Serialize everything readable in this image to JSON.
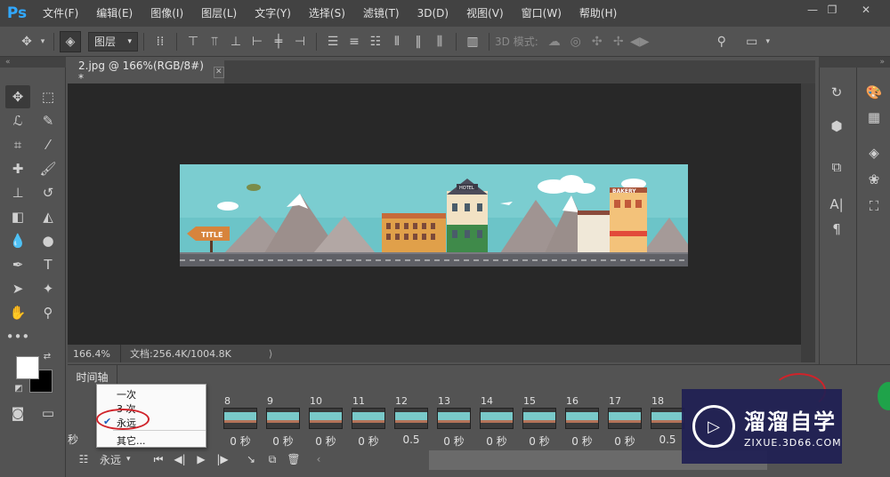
{
  "app": {
    "logo": "Ps"
  },
  "menubar": {
    "items": [
      "文件(F)",
      "编辑(E)",
      "图像(I)",
      "图层(L)",
      "文字(Y)",
      "选择(S)",
      "滤镜(T)",
      "3D(D)",
      "视图(V)",
      "窗口(W)",
      "帮助(H)"
    ],
    "window_controls": [
      "minimize-icon",
      "restore-icon",
      "close-icon"
    ]
  },
  "options_bar": {
    "auto_select_target": "图层",
    "mode_3d_label": "3D 模式:"
  },
  "document": {
    "tab_title": "2.jpg @ 166%(RGB/8#) *",
    "image_texts": {
      "hotel": "HOTEL",
      "bakery": "BAKERY",
      "title_sign": "TITLE"
    }
  },
  "status": {
    "zoom": "166.4%",
    "doc_info": "文档:256.4K/1004.8K",
    "arrow": "⟩"
  },
  "timeline": {
    "title": "时间轴",
    "frames": [
      {
        "num": "8",
        "delay": "0 秒"
      },
      {
        "num": "9",
        "delay": "0 秒"
      },
      {
        "num": "10",
        "delay": "0 秒"
      },
      {
        "num": "11",
        "delay": "0 秒"
      },
      {
        "num": "12",
        "delay": "0.5"
      },
      {
        "num": "13",
        "delay": "0 秒"
      },
      {
        "num": "14",
        "delay": "0 秒"
      },
      {
        "num": "15",
        "delay": "0 秒"
      },
      {
        "num": "16",
        "delay": "0 秒"
      },
      {
        "num": "17",
        "delay": "0 秒"
      },
      {
        "num": "18",
        "delay": "0.5"
      }
    ],
    "first_frame_delay_fragment": "秒",
    "loop_value": "永远"
  },
  "loop_dropdown": {
    "options": [
      "一次",
      "3 次",
      "永远",
      "其它..."
    ],
    "selected": "永远"
  },
  "watermark": {
    "title": "溜溜自学",
    "url": "ZIXUE.3D66.COM"
  },
  "colors": {
    "foreground": "#ffffff",
    "background": "#000000",
    "accent": "#31a8ff"
  }
}
